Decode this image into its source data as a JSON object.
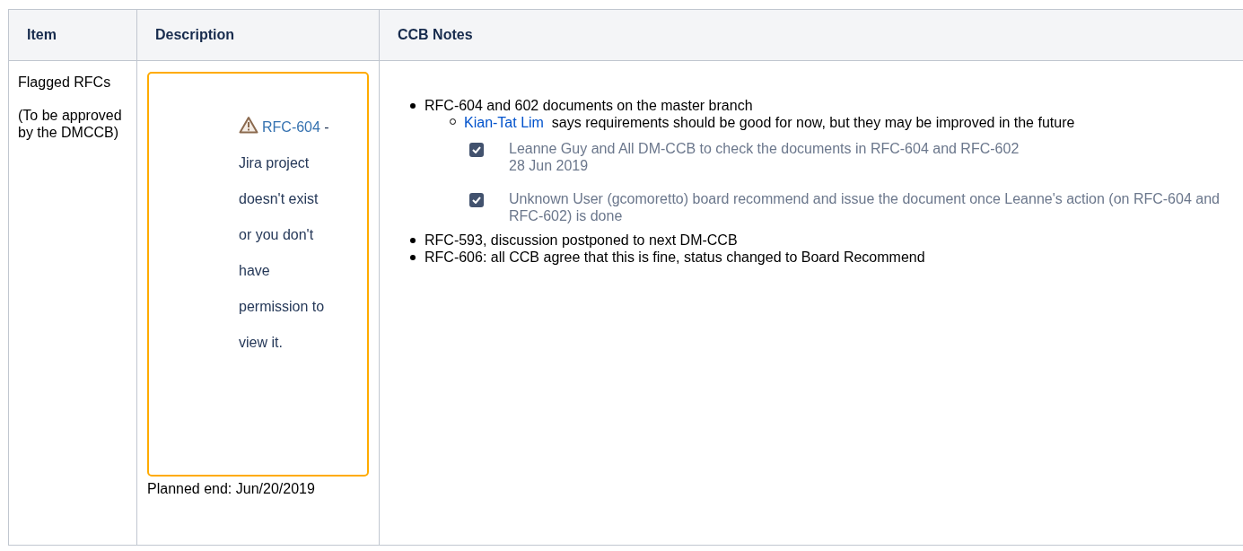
{
  "table": {
    "columns": [
      "Item",
      "Description",
      "CCB Notes"
    ],
    "rows": [
      {
        "item": [
          "Flagged RFCs",
          "(To be approved by the DMCCB)"
        ],
        "description": {
          "link": "RFC-604",
          "message": " - Jira project doesn't exist or you don't have permission to view it.",
          "planned_end": "Planned end: Jun/20/2019"
        },
        "notes": [
          {
            "text": "RFC-604 and 602 documents on the master branch",
            "children": [
              {
                "mention": "Kian-Tat Lim",
                "text": " says requirements should be good for now, but they may be improved in the future"
              }
            ],
            "tasks": [
              {
                "text": "Leanne Guy and All DM-CCB to check the documents in RFC-604 and RFC-602",
                "date": "28 Jun 2019",
                "checked": true
              },
              {
                "text": "Unknown User (gcomoretto) board recommend and issue the document once Leanne's action (on RFC-604 and RFC-602) is done",
                "checked": true
              }
            ]
          },
          {
            "text": "RFC-593, discussion postponed to next DM-CCB"
          },
          {
            "text": "RFC-606: all CCB agree that this is fine, status changed to Board Recommend"
          }
        ]
      }
    ]
  }
}
